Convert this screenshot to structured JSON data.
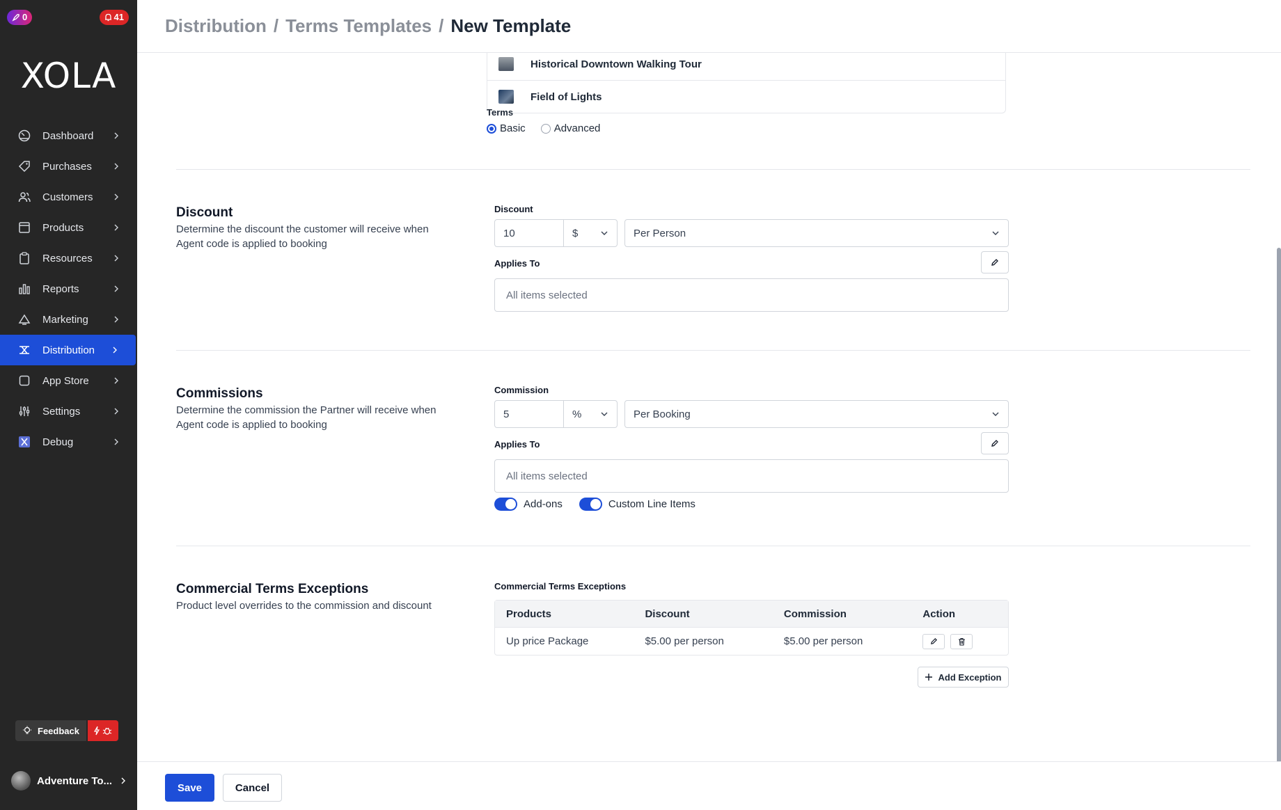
{
  "sidebar": {
    "updates_badge": "0",
    "notifications_badge": "41",
    "logo": "XOLA",
    "items": [
      {
        "label": "Dashboard",
        "icon": "dashboard-icon"
      },
      {
        "label": "Purchases",
        "icon": "tag-icon"
      },
      {
        "label": "Customers",
        "icon": "users-icon"
      },
      {
        "label": "Products",
        "icon": "box-icon"
      },
      {
        "label": "Resources",
        "icon": "clipboard-icon"
      },
      {
        "label": "Reports",
        "icon": "bar-chart-icon"
      },
      {
        "label": "Marketing",
        "icon": "megaphone-icon"
      },
      {
        "label": "Distribution",
        "icon": "distribution-icon",
        "active": true
      },
      {
        "label": "App Store",
        "icon": "app-store-icon"
      },
      {
        "label": "Settings",
        "icon": "sliders-icon"
      },
      {
        "label": "Debug",
        "icon": "debug-icon"
      }
    ],
    "feedback_label": "Feedback",
    "account_name": "Adventure To..."
  },
  "header": {
    "crumbs": [
      "Distribution",
      "Terms Templates",
      "New Template"
    ]
  },
  "products": [
    {
      "name": "Historical Downtown Walking Tour"
    },
    {
      "name": "Field of Lights"
    }
  ],
  "terms": {
    "label": "Terms",
    "options": [
      "Basic",
      "Advanced"
    ],
    "selected": "Basic"
  },
  "discount": {
    "title": "Discount",
    "description": "Determine the discount the customer will receive when Agent code is applied to booking",
    "field_label": "Discount",
    "amount": "10",
    "unit": "$",
    "per": "Per Person",
    "applies_label": "Applies To",
    "applies_value": "All items selected"
  },
  "commission": {
    "title": "Commissions",
    "description": "Determine the commission the Partner will receive when Agent code is applied to booking",
    "field_label": "Commission",
    "amount": "5",
    "unit": "%",
    "per": "Per Booking",
    "applies_label": "Applies To",
    "applies_value": "All items selected",
    "toggles": [
      {
        "label": "Add-ons",
        "on": true
      },
      {
        "label": "Custom Line Items",
        "on": true
      }
    ]
  },
  "exceptions": {
    "title": "Commercial Terms Exceptions",
    "description": "Product level overrides to the commission and discount",
    "table_label": "Commercial Terms Exceptions",
    "columns": [
      "Products",
      "Discount",
      "Commission",
      "Action"
    ],
    "rows": [
      {
        "product": "Up price Package",
        "discount": "$5.00 per person",
        "commission": "$5.00 per person"
      }
    ],
    "add_label": "Add Exception"
  },
  "footer": {
    "save_label": "Save",
    "cancel_label": "Cancel"
  },
  "colors": {
    "sidebar_bg": "#262626",
    "accent": "#1d4ed8",
    "danger": "#dc2626"
  }
}
